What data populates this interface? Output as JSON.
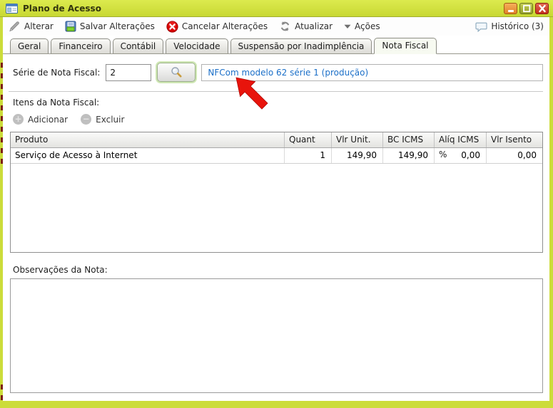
{
  "window": {
    "title": "Plano de Acesso"
  },
  "toolbar": {
    "alterar": "Alterar",
    "salvar": "Salvar Alterações",
    "cancelar": "Cancelar Alterações",
    "atualizar": "Atualizar",
    "acoes": "Ações",
    "historico": "Histórico (3)"
  },
  "tabs": {
    "items": [
      "Geral",
      "Financeiro",
      "Contábil",
      "Velocidade",
      "Suspensão por Inadimplência",
      "Nota Fiscal"
    ],
    "active": "Nota Fiscal"
  },
  "form": {
    "serie_label": "Série de Nota Fiscal:",
    "serie_value": "2",
    "serie_info": "NFCom modelo 62 série 1 (produção)",
    "itens_label": "Itens da Nota Fiscal:",
    "adicionar": "Adicionar",
    "excluir": "Excluir",
    "observacoes_label": "Observações da Nota:",
    "observacoes_value": ""
  },
  "table": {
    "columns": [
      "Produto",
      "Quant",
      "Vlr Unit.",
      "BC ICMS",
      "Alíq ICMS %",
      "Vlr Isento"
    ],
    "rows": [
      [
        "Serviço de Acesso à Internet",
        "1",
        "149,90",
        "149,90",
        "0,00",
        "0,00"
      ]
    ]
  },
  "colors": {
    "titlebar_yellow_green": "#ccdc3a",
    "link_blue": "#1b6fc8",
    "cancel_red": "#d40000",
    "arrow_red": "#e8140c",
    "minimize_orange": "#e8862a",
    "maximize_olive": "#9aa42c",
    "close_red": "#c93122",
    "save_green": "#6fc421",
    "save_blue": "#3d6ea5"
  }
}
